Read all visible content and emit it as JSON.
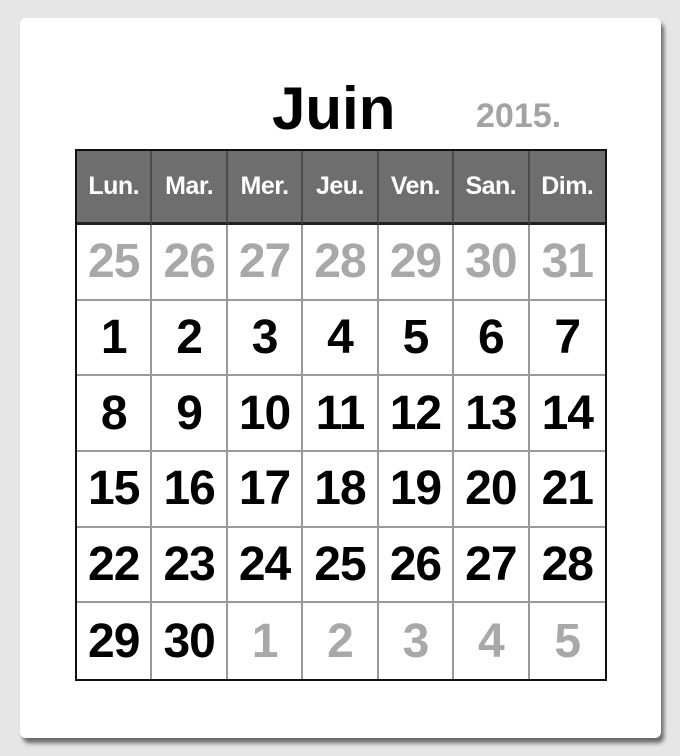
{
  "calendar": {
    "month": "Juin",
    "year": "2015.",
    "weekdays": [
      "Lun.",
      "Mar.",
      "Mer.",
      "Jeu.",
      "Ven.",
      "San.",
      "Dim."
    ],
    "weeks": [
      [
        {
          "d": "25",
          "other": true
        },
        {
          "d": "26",
          "other": true
        },
        {
          "d": "27",
          "other": true
        },
        {
          "d": "28",
          "other": true
        },
        {
          "d": "29",
          "other": true
        },
        {
          "d": "30",
          "other": true
        },
        {
          "d": "31",
          "other": true
        }
      ],
      [
        {
          "d": "1",
          "other": false
        },
        {
          "d": "2",
          "other": false
        },
        {
          "d": "3",
          "other": false
        },
        {
          "d": "4",
          "other": false
        },
        {
          "d": "5",
          "other": false
        },
        {
          "d": "6",
          "other": false
        },
        {
          "d": "7",
          "other": false
        }
      ],
      [
        {
          "d": "8",
          "other": false
        },
        {
          "d": "9",
          "other": false
        },
        {
          "d": "10",
          "other": false
        },
        {
          "d": "11",
          "other": false
        },
        {
          "d": "12",
          "other": false
        },
        {
          "d": "13",
          "other": false
        },
        {
          "d": "14",
          "other": false
        }
      ],
      [
        {
          "d": "15",
          "other": false
        },
        {
          "d": "16",
          "other": false
        },
        {
          "d": "17",
          "other": false
        },
        {
          "d": "18",
          "other": false
        },
        {
          "d": "19",
          "other": false
        },
        {
          "d": "20",
          "other": false
        },
        {
          "d": "21",
          "other": false
        }
      ],
      [
        {
          "d": "22",
          "other": false
        },
        {
          "d": "23",
          "other": false
        },
        {
          "d": "24",
          "other": false
        },
        {
          "d": "25",
          "other": false
        },
        {
          "d": "26",
          "other": false
        },
        {
          "d": "27",
          "other": false
        },
        {
          "d": "28",
          "other": false
        }
      ],
      [
        {
          "d": "29",
          "other": false
        },
        {
          "d": "30",
          "other": false
        },
        {
          "d": "1",
          "other": true
        },
        {
          "d": "2",
          "other": true
        },
        {
          "d": "3",
          "other": true
        },
        {
          "d": "4",
          "other": true
        },
        {
          "d": "5",
          "other": true
        }
      ]
    ]
  },
  "colors": {
    "background": "#e6e6e6",
    "card": "#ffffff",
    "header_bg": "#6e6e6e",
    "header_text": "#ffffff",
    "day_text": "#000000",
    "other_month_text": "#a8a8a8",
    "year_text": "#a3a3a3",
    "grid_border": "#111111",
    "cell_border": "#9a9a9a"
  }
}
